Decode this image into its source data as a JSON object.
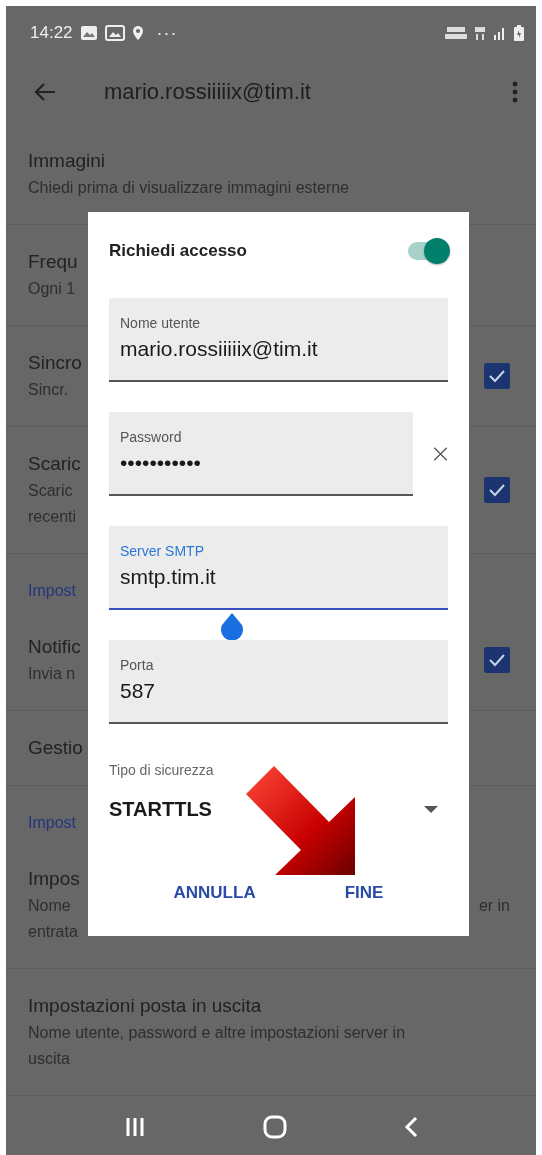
{
  "status_bar": {
    "time": "14:22",
    "more": "···"
  },
  "app_bar": {
    "title": "mario.rossiiiiix@tim.it"
  },
  "settings": [
    {
      "kind": "item",
      "title": "Immagini",
      "lines": [
        [
          "Chiedi prima di visualizzare immagini esterne"
        ]
      ]
    },
    {
      "kind": "item",
      "title": "Frequ",
      "lines": [
        [
          "Ogni 1"
        ]
      ]
    },
    {
      "kind": "item",
      "title": "Sincro",
      "lines": [
        [
          "Sincr."
        ]
      ],
      "checked": true
    },
    {
      "kind": "item",
      "title": "Scaric",
      "lines": [
        [
          "Scaric"
        ],
        [
          "recenti"
        ]
      ],
      "checked": true
    },
    {
      "kind": "header",
      "title": "Impost"
    },
    {
      "kind": "item",
      "title": "Notific",
      "lines": [
        [
          "Invia n"
        ]
      ],
      "checked": true
    },
    {
      "kind": "item",
      "title": "Gestio"
    },
    {
      "kind": "header",
      "title": "Impost"
    },
    {
      "kind": "item",
      "title": "Impos",
      "lines": [
        [
          "Nome",
          "er in"
        ],
        [
          "entrata"
        ]
      ]
    },
    {
      "kind": "item",
      "title": "Impostazioni posta in uscita",
      "lines": [
        [
          "Nome utente, password e altre impostazioni server in"
        ],
        [
          "uscita"
        ]
      ]
    }
  ],
  "dialog": {
    "toggle": {
      "label": "Richiedi accesso",
      "on": true
    },
    "fields": [
      {
        "kind": "text",
        "label": "Nome utente",
        "value": "mario.rossiiiiix@tim.it",
        "focused": false
      },
      {
        "kind": "password",
        "label": "Password",
        "value": "•••••••••••",
        "focused": false
      },
      {
        "kind": "text",
        "label": "Server SMTP",
        "value": "smtp.tim.it",
        "focused": true
      },
      {
        "kind": "text",
        "label": "Porta",
        "value": "587",
        "focused": false
      }
    ],
    "dropdown": {
      "label": "Tipo di sicurezza",
      "value": "STARTTLS"
    },
    "buttons": [
      "ANNULLA",
      "FINE"
    ]
  }
}
